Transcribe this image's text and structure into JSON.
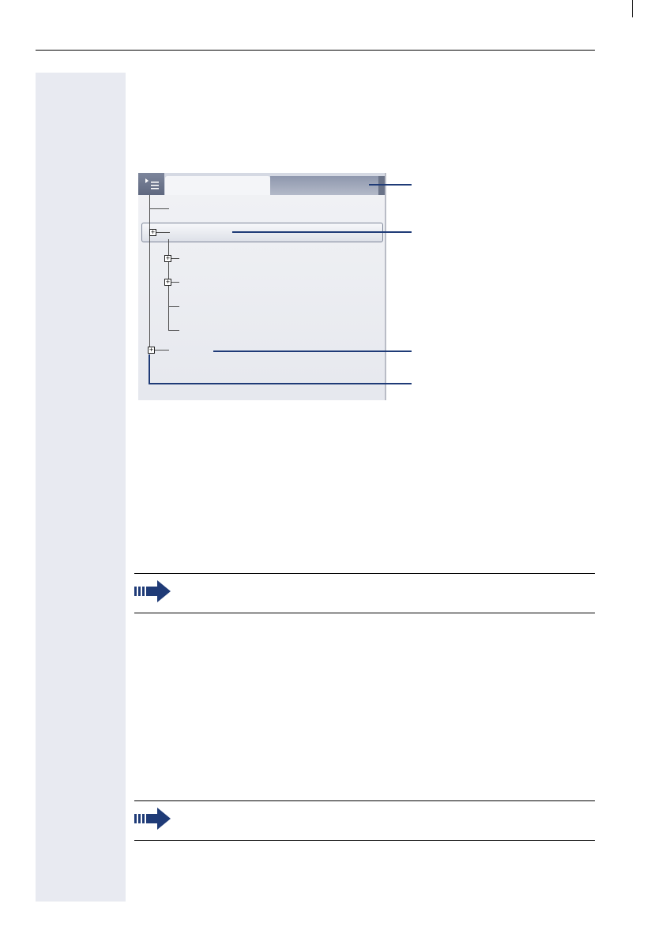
{
  "document": {
    "icons": {
      "menu": "menu-icon",
      "note": "note-arrow-icon",
      "expander": "expand-plus-icon"
    },
    "colors": {
      "margin_band": "#e8eaf1",
      "callout": "#1f3b77",
      "note_arrow": "#1f3b77"
    }
  }
}
